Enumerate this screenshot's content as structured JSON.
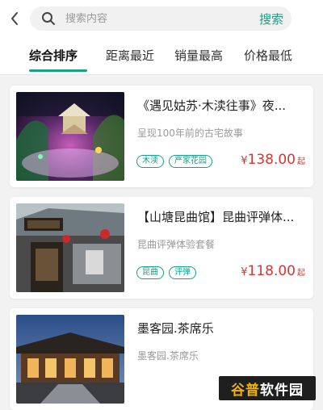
{
  "search": {
    "placeholder": "搜索内容",
    "button_label": "搜索"
  },
  "tabs": [
    {
      "label": "综合排序",
      "active": true
    },
    {
      "label": "距离最近",
      "active": false
    },
    {
      "label": "销量最高",
      "active": false
    },
    {
      "label": "价格最低",
      "active": false
    }
  ],
  "colors": {
    "accent": "#16a085",
    "price": "#e0312f"
  },
  "items": [
    {
      "title": "《遇见姑苏·木渎往事》夜...",
      "subtitle": "呈现100年前的古宅故事",
      "tags": [
        "木渎",
        "严家花园"
      ],
      "price_symbol": "¥",
      "price": "138.00",
      "price_unit": "起"
    },
    {
      "title": "【山塘昆曲馆】昆曲评弹体...",
      "subtitle": "昆曲评弹体验套餐",
      "tags": [
        "昆曲",
        "评弹"
      ],
      "price_symbol": "¥",
      "price": "118.00",
      "price_unit": "起"
    },
    {
      "title": "墨客园.茶席乐",
      "subtitle": "墨客园.茶席乐",
      "tags": [],
      "price_symbol": "",
      "price": "",
      "price_unit": ""
    }
  ],
  "icons": {
    "back": "chevron-left-icon",
    "search": "search-icon"
  },
  "watermark": {
    "highlight": "谷普",
    "rest": "软件园"
  }
}
